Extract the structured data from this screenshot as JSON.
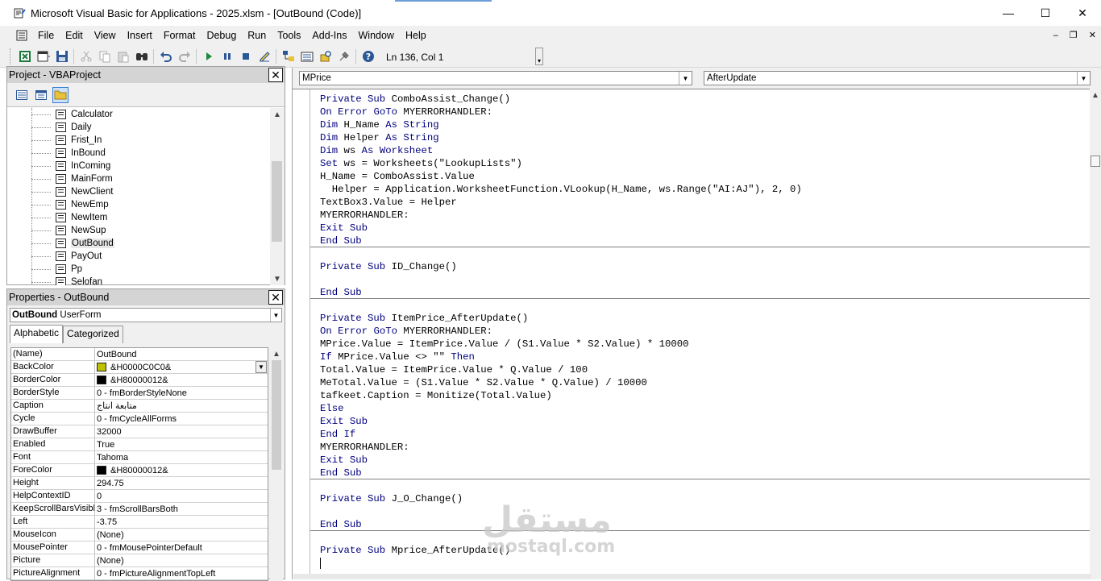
{
  "window": {
    "title": "Microsoft Visual Basic for Applications - 2025.xlsm - [OutBound (Code)]",
    "controls": [
      "—",
      "☐",
      "✕"
    ],
    "mdi_controls": [
      "–",
      "❐",
      "✕"
    ]
  },
  "menu": [
    "File",
    "Edit",
    "View",
    "Insert",
    "Format",
    "Debug",
    "Run",
    "Tools",
    "Add-Ins",
    "Window",
    "Help"
  ],
  "toolbar": {
    "position": "Ln 136, Col 1",
    "buttons": [
      "view-excel-icon",
      "insert-userform-icon",
      "save-icon",
      "cut-icon",
      "copy-icon",
      "paste-icon",
      "find-icon",
      "undo-icon",
      "redo-icon",
      "run-icon",
      "break-icon",
      "reset-icon",
      "design-mode-icon",
      "project-explorer-icon",
      "properties-icon",
      "object-browser-icon",
      "toolbox-icon",
      "help-icon"
    ]
  },
  "project": {
    "title": "Project - VBAProject",
    "close": "✕",
    "items": [
      "Calculator",
      "Daily",
      "Frist_In",
      "InBound",
      "InComing",
      "MainForm",
      "NewClient",
      "NewEmp",
      "NewItem",
      "NewSup",
      "OutBound",
      "PayOut",
      "Pp",
      "Selofan"
    ],
    "selected": "OutBound"
  },
  "properties": {
    "title": "Properties - OutBound",
    "close": "✕",
    "object_name": "OutBound",
    "object_type": "UserForm",
    "tabs": [
      "Alphabetic",
      "Categorized"
    ],
    "active_tab": "Alphabetic",
    "rows": [
      {
        "k": "(Name)",
        "v": "OutBound"
      },
      {
        "k": "BackColor",
        "v": "&H0000C0C0&",
        "swatch": "#c0c000"
      },
      {
        "k": "BorderColor",
        "v": "&H80000012&",
        "swatch": "#000000"
      },
      {
        "k": "BorderStyle",
        "v": "0 - fmBorderStyleNone"
      },
      {
        "k": "Caption",
        "v": "متابعة انتاج"
      },
      {
        "k": "Cycle",
        "v": "0 - fmCycleAllForms"
      },
      {
        "k": "DrawBuffer",
        "v": "32000"
      },
      {
        "k": "Enabled",
        "v": "True"
      },
      {
        "k": "Font",
        "v": "Tahoma"
      },
      {
        "k": "ForeColor",
        "v": "&H80000012&",
        "swatch": "#000000"
      },
      {
        "k": "Height",
        "v": "294.75"
      },
      {
        "k": "HelpContextID",
        "v": "0"
      },
      {
        "k": "KeepScrollBarsVisible",
        "v": "3 - fmScrollBarsBoth"
      },
      {
        "k": "Left",
        "v": "-3.75"
      },
      {
        "k": "MouseIcon",
        "v": "(None)"
      },
      {
        "k": "MousePointer",
        "v": "0 - fmMousePointerDefault"
      },
      {
        "k": "Picture",
        "v": "(None)"
      },
      {
        "k": "PictureAlignment",
        "v": "0 - fmPictureAlignmentTopLeft"
      }
    ]
  },
  "code": {
    "object_combo": "MPrice",
    "proc_combo": "AfterUpdate",
    "procedures": [
      [
        "Private Sub ComboAssist_Change()",
        "On Error GoTo MYERRORHANDLER:",
        "Dim H_Name As String",
        "Dim Helper As String",
        "Dim ws As Worksheet",
        "Set ws = Worksheets(\"LookupLists\")",
        "H_Name = ComboAssist.Value",
        "  Helper = Application.WorksheetFunction.VLookup(H_Name, ws.Range(\"AI:AJ\"), 2, 0)",
        "TextBox3.Value = Helper",
        "MYERRORHANDLER:",
        "Exit Sub",
        "End Sub"
      ],
      [
        "",
        "Private Sub ID_Change()",
        "",
        "End Sub"
      ],
      [
        "",
        "Private Sub ItemPrice_AfterUpdate()",
        "On Error GoTo MYERRORHANDLER:",
        "MPrice.Value = ItemPrice.Value / (S1.Value * S2.Value) * 10000",
        "If MPrice.Value <> \"\" Then",
        "Total.Value = ItemPrice.Value * Q.Value / 100",
        "MeTotal.Value = (S1.Value * S2.Value * Q.Value) / 10000",
        "tafkeet.Caption = Monitize(Total.Value)",
        "Else",
        "Exit Sub",
        "End If",
        "MYERRORHANDLER:",
        "Exit Sub",
        "End Sub"
      ],
      [
        "",
        "Private Sub J_O_Change()",
        "",
        "End Sub"
      ],
      [
        "",
        "Private Sub Mprice_AfterUpdate()",
        ""
      ]
    ]
  },
  "watermark": {
    "arabic": "مستقل",
    "latin": "mostaql.com"
  }
}
